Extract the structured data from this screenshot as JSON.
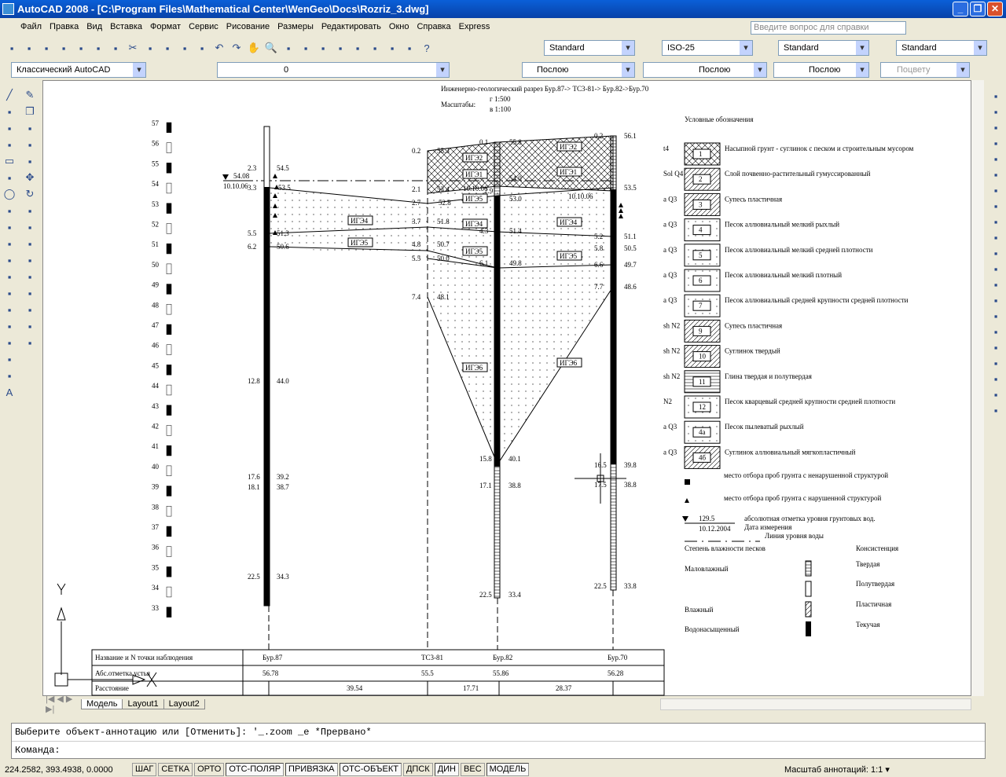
{
  "window": {
    "title": "AutoCAD 2008 - [C:\\Program Files\\Mathematical Center\\WenGeo\\Docs\\Rozriz_3.dwg]"
  },
  "menu": [
    "Файл",
    "Правка",
    "Вид",
    "Вставка",
    "Формат",
    "Сервис",
    "Рисование",
    "Размеры",
    "Редактировать",
    "Окно",
    "Справка",
    "Express"
  ],
  "help_placeholder": "Введите вопрос для справки",
  "toolbar1_icons": [
    "new-icon",
    "open-icon",
    "save-icon",
    "plot-icon",
    "plot-preview-icon",
    "publish-icon",
    "web-icon",
    "cut-icon",
    "copy-icon",
    "paste-icon",
    "match-properties-icon",
    "block-editor-icon",
    "undo-icon",
    "redo-icon",
    "pan-icon",
    "zoom-realtime-icon",
    "zoom-window-icon",
    "zoom-previous-icon",
    "properties-icon",
    "design-center-icon",
    "tool-palettes-icon",
    "sheet-set-icon",
    "markup-icon",
    "calculator-icon",
    "help-icon"
  ],
  "styles": {
    "text": "Standard",
    "dim": "ISO-25",
    "table": "Standard",
    "mleader": "Standard"
  },
  "workspace": "Классический AutoCAD",
  "layer": "0",
  "color": "Послою",
  "linetype": "Послою",
  "lineweight": "Послою",
  "plotstyle": "Поцвету",
  "left_icons": [
    "line-icon",
    "construction-line-icon",
    "polyline-icon",
    "polygon-icon",
    "rectangle-icon",
    "arc-icon",
    "circle-icon",
    "revcloud-icon",
    "spline-icon",
    "ellipse-icon",
    "ellipse-arc-icon",
    "insert-block-icon",
    "make-block-icon",
    "point-icon",
    "hatch-icon",
    "gradient-icon",
    "region-icon",
    "table-icon",
    "mtext-icon"
  ],
  "left_icons2": [
    "erase-icon",
    "copy-object-icon",
    "mirror-icon",
    "offset-icon",
    "array-icon",
    "move-icon",
    "rotate-icon",
    "scale-icon",
    "stretch-icon",
    "trim-icon",
    "extend-icon",
    "break-icon",
    "join-icon",
    "chamfer-icon",
    "fillet-icon",
    "explode-icon"
  ],
  "right_icons": [
    "dim-linear-icon",
    "dim-aligned-icon",
    "dim-arc-icon",
    "dim-ordinate-icon",
    "dim-radius-icon",
    "dim-jogged-icon",
    "dim-diameter-icon",
    "dim-angular-icon",
    "quick-dim-icon",
    "dim-baseline-icon",
    "dim-continue-icon",
    "dim-space-icon",
    "dim-break-icon",
    "tolerance-icon",
    "center-mark-icon",
    "inspect-icon",
    "jogged-linear-icon",
    "dim-edit-icon",
    "dim-text-edit-icon",
    "dim-update-icon",
    "dim-style-icon"
  ],
  "drawing": {
    "title": "Инженерно-геологический разрез Бур.87-> ТС3-81-> Бур.82->Бур.70",
    "scales_label": "Масштабы:",
    "scale_h": "г 1:500",
    "scale_v": "в 1:100",
    "elevations": [
      "57",
      "56",
      "55",
      "54",
      "53",
      "52",
      "51",
      "50",
      "49",
      "48",
      "47",
      "46",
      "45",
      "44",
      "43",
      "42",
      "41",
      "40",
      "39",
      "38",
      "37",
      "36",
      "35",
      "34",
      "33"
    ],
    "water": {
      "level": "54.08",
      "date": "10.10.06",
      "date2": "10.10.06",
      "date3": "10.10.06"
    },
    "labels": [
      "2.3",
      "54.5",
      "3.3",
      "53.5",
      "5.5",
      "51.3",
      "6.2",
      "50.6",
      "12.8",
      "44.0",
      "17.6",
      "39.2",
      "18.1",
      "38.7",
      "22.5",
      "34.3",
      "0.2",
      "55.3",
      "2.1",
      "53.4",
      "2.7",
      "52.8",
      "3.7",
      "51.8",
      "4.8",
      "50.7",
      "5.5",
      "50.0",
      "7.4",
      "48.1",
      "15.8",
      "40.1",
      "0.1",
      "55.8",
      "54.0",
      "2.9",
      "53.0",
      "4.3",
      "51.4",
      "6.1",
      "49.8",
      "17.1",
      "38.8",
      "22.5",
      "33.4",
      "0.2",
      "56.1",
      "53.5",
      "5.2",
      "51.1",
      "5.8",
      "50.5",
      "6.6",
      "49.7",
      "7.7",
      "48.6",
      "16.5",
      "39.8",
      "17.5",
      "38.8",
      "22.5",
      "33.8"
    ],
    "layers": [
      "ИГЭ4",
      "ИГЭ5",
      "ИГЭ1",
      "ИГЭ5",
      "ИГЭ4",
      "ИГЭ5",
      "ИГЭ1",
      "ИГЭ4",
      "ИГЭ5",
      "ИГЭ6",
      "ИГЭ6",
      "ИГЭ2",
      "ИГЭ2"
    ],
    "table": {
      "rows": [
        "Название и N точки наблюдения",
        "Абс.отметка устья",
        "Расстояние"
      ],
      "points": [
        "Бур.87",
        "ТС3-81",
        "Бур.82",
        "Бур.70"
      ],
      "elev": [
        "56.78",
        "55.5",
        "55.86",
        "56.28"
      ],
      "dist": [
        "39.54",
        "17.71",
        "28.37"
      ]
    },
    "legend": {
      "title": "Условные обозначения",
      "items": [
        {
          "idx": "t4",
          "num": "1",
          "text": "Насыпной грунт - суглинок с песком и строительным мусором"
        },
        {
          "idx": "Sol Q4",
          "num": "2",
          "text": "Слой почвенно-растительный гумуссированный"
        },
        {
          "idx": "a Q3",
          "num": "3",
          "text": "Супесь пластичная"
        },
        {
          "idx": "a Q3",
          "num": "4",
          "text": "Песок аллювиальный мелкий рыхлый"
        },
        {
          "idx": "a Q3",
          "num": "5",
          "text": "Песок аллювиальный мелкий средней плотности"
        },
        {
          "idx": "a Q3",
          "num": "6",
          "text": "Песок аллювиальный мелкий плотный"
        },
        {
          "idx": "a Q3",
          "num": "7",
          "text": "Песок аллювиальный средней крупности средней плотности"
        },
        {
          "idx": "sh N2",
          "num": "9",
          "text": "Супесь пластичная"
        },
        {
          "idx": "sh N2",
          "num": "10",
          "text": "Суглинок твердый"
        },
        {
          "idx": "sh N2",
          "num": "11",
          "text": "Глина твердая и полутвердая"
        },
        {
          "idx": "N2",
          "num": "12",
          "text": "Песок кварцевый средней крупности средней плотности"
        },
        {
          "idx": "a Q3",
          "num": "4а",
          "text": "Песок пылеватый рыхлый"
        },
        {
          "idx": "a Q3",
          "num": "4б",
          "text": "Суглинок аллювиальный мягкопластичный"
        }
      ],
      "sample_undisturbed": "место отбора проб грунта с ненарушенной структурой",
      "sample_disturbed": "место отбора проб грунта с нарушенной структурой",
      "water_level": "129.5",
      "water_date": "10.12.2004",
      "water_text": "абсолютная отметка уровня грунтовых вод.",
      "date_text": "Дата измерения",
      "line_text": "Линия уровня воды",
      "moisture_title": "Степень влажности песков",
      "consistency_title": "Консистенция",
      "moisture": [
        "Маловлажный",
        "Влажный",
        "Водонасыщенный"
      ],
      "consistency": [
        "Твердая",
        "Полутвердая",
        "Пластичная",
        "Текучая"
      ]
    }
  },
  "tabs": [
    "Модель",
    "Layout1",
    "Layout2"
  ],
  "command": {
    "history": "Выберите объект-аннотацию или [Отменить]: '_.zoom _e *Прервано*",
    "prompt": "Команда:"
  },
  "status": {
    "coords": "224.2582, 393.4938, 0.0000",
    "buttons": [
      {
        "l": "ШАГ",
        "on": false
      },
      {
        "l": "СЕТКА",
        "on": false
      },
      {
        "l": "ОРТО",
        "on": false
      },
      {
        "l": "ОТС-ПОЛЯР",
        "on": true
      },
      {
        "l": "ПРИВЯЗКА",
        "on": true
      },
      {
        "l": "ОТС-ОБЪЕКТ",
        "on": true
      },
      {
        "l": "ДПСК",
        "on": false
      },
      {
        "l": "ДИН",
        "on": true
      },
      {
        "l": "ВЕС",
        "on": false
      },
      {
        "l": "МОДЕЛЬ",
        "on": true
      }
    ],
    "annotation_scale": "Масштаб аннотаций:  1:1 ▾"
  }
}
